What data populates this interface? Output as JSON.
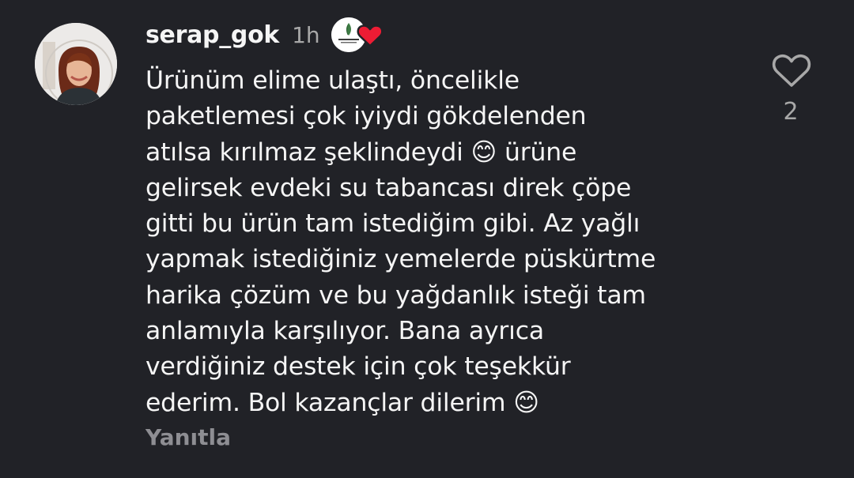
{
  "comment": {
    "username": "serap_gok",
    "time": "1h",
    "text": "Ürünüm elime ulaştı, öncelikle\npaketlemesi çok iyiydi gökdelenden\natılsa kırılmaz şeklindeydi 😊 ürüne\ngelirsek evdeki su tabancası direk çöpe\ngitti bu ürün tam istediğim gibi. Az yağlı\nyapmak istediğiniz yemelerde püskürtme\nharika çözüm ve bu yağdanlık isteği tam\nanlamıyla karşılıyor. Bana ayrıca\nverdiğiniz destek için çok teşekkür\nederim. Bol kazançlar dilerim 😊",
    "reply_label": "Yanıtla",
    "like_count": "2"
  },
  "icons": {
    "avatar": "profile-photo",
    "creator_badge": "brand-logo",
    "creator_heart": "heart-filled-icon",
    "like": "heart-outline-icon"
  },
  "colors": {
    "background": "#212227",
    "heart_red": "#ed1c34",
    "muted": "#a8a8a8"
  }
}
